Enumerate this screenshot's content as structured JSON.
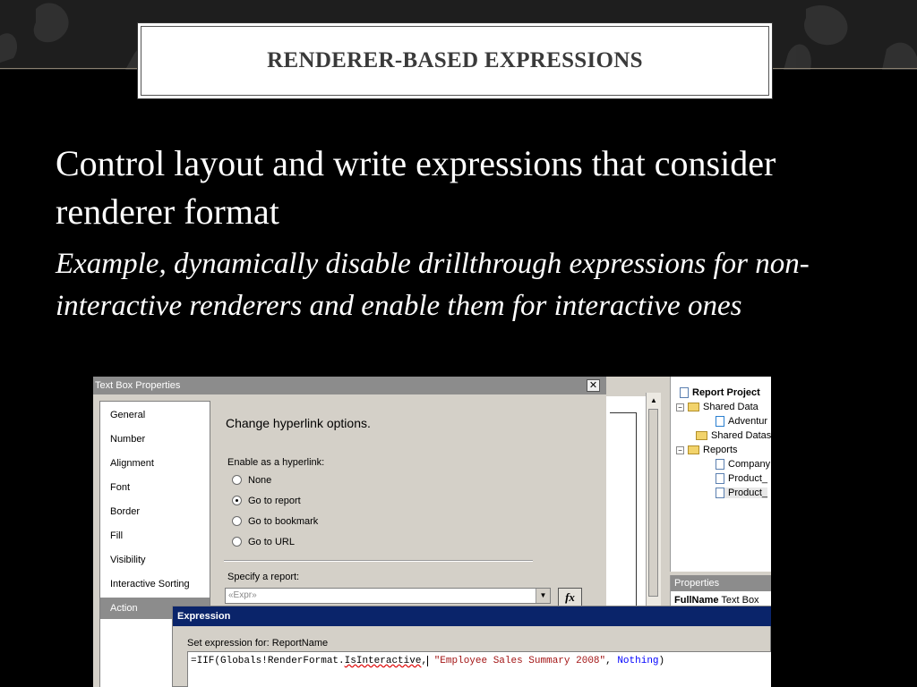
{
  "slide": {
    "title": "RENDERER-BASED EXPRESSIONS",
    "heading": "Control layout and write expressions that consider renderer format",
    "subheading": "Example, dynamically disable drillthrough expressions for non-interactive renderers and enable them for interactive ones"
  },
  "dialog": {
    "title": "Text Box Properties",
    "close_icon": "close-icon",
    "nav_items": [
      "General",
      "Number",
      "Alignment",
      "Font",
      "Border",
      "Fill",
      "Visibility",
      "Interactive Sorting",
      "Action"
    ],
    "selected_nav": "Action",
    "pane_title": "Change hyperlink options.",
    "enable_label": "Enable as a hyperlink:",
    "options": [
      {
        "label": "None",
        "checked": false
      },
      {
        "label": "Go to report",
        "checked": true
      },
      {
        "label": "Go to bookmark",
        "checked": false
      },
      {
        "label": "Go to URL",
        "checked": false
      }
    ],
    "specify_label": "Specify a report:",
    "report_value": "«Expr»",
    "fx_label": "fx"
  },
  "solution_explorer": {
    "project": "Report Project",
    "items": [
      "Shared Data",
      "Adventur",
      "Shared Datas",
      "Reports",
      "Company",
      "Product_",
      "Product_"
    ]
  },
  "properties": {
    "header": "Properties",
    "row_name": "FullName",
    "row_value": "Text Box"
  },
  "expression_dialog": {
    "title": "Expression",
    "label": "Set expression for: ReportName",
    "code_prefix": "=IIF(Globals!RenderFormat.",
    "code_member": "IsInteractive",
    "code_comma": ",",
    "code_string": "\"Employee Sales Summary 2008\"",
    "code_sep": ", ",
    "code_keyword": "Nothing",
    "code_suffix": ")"
  }
}
